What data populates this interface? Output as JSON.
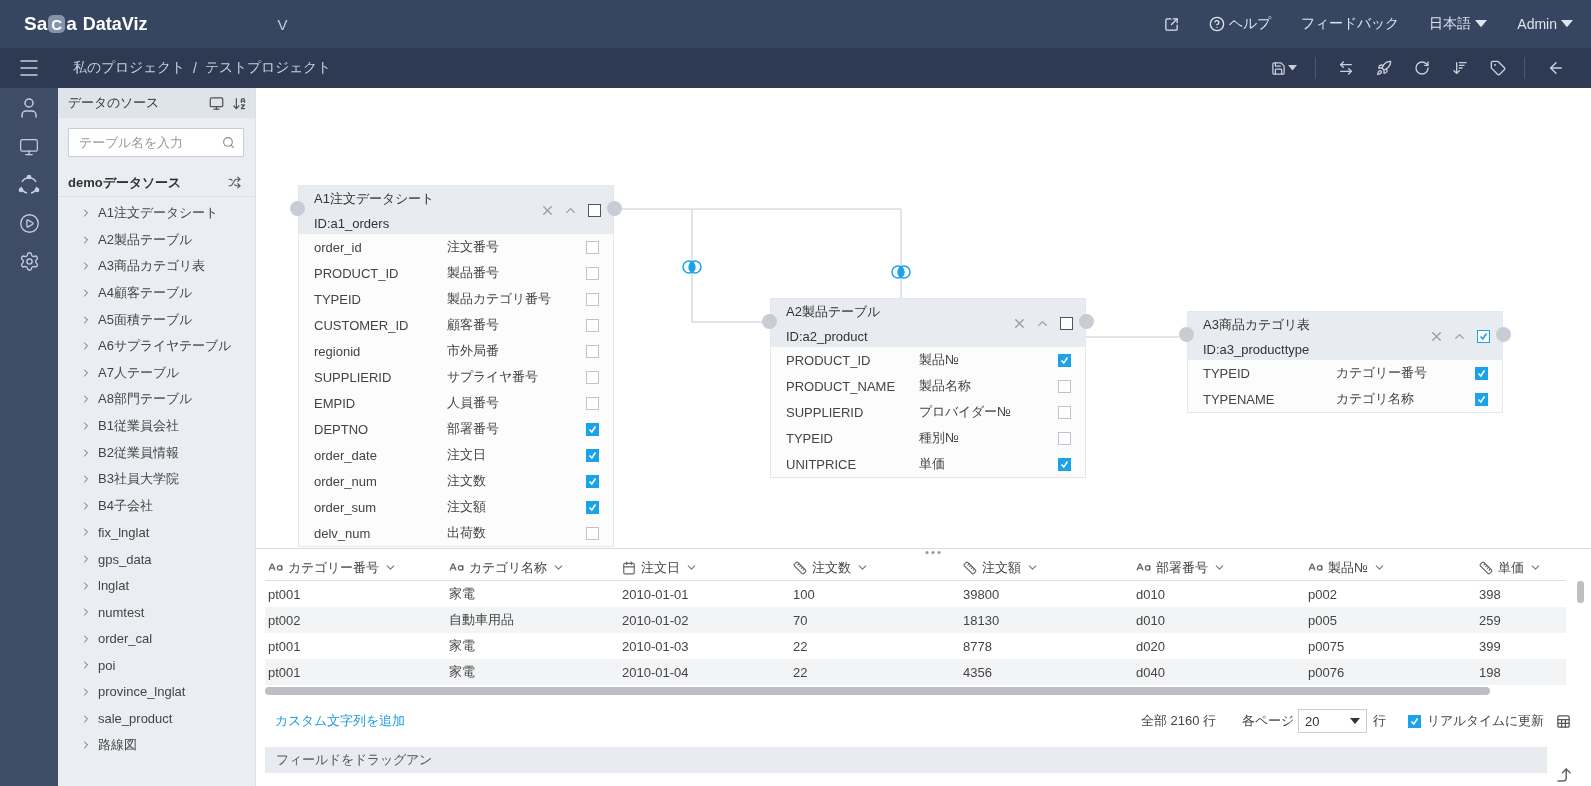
{
  "topbar": {
    "logo": [
      "Sa",
      "C",
      "a"
    ],
    "product": "DataViz",
    "version": "V",
    "help": "ヘルプ",
    "feedback": "フィードバック",
    "language": "日本語",
    "user": "Admin"
  },
  "breadcrumb": {
    "items": [
      "私のプロジェクト",
      "テストプロジェクト"
    ],
    "separator": "/"
  },
  "sidebar": {
    "title": "データのソース",
    "search": {
      "placeholder": "テーブル名を入力"
    },
    "group": "demoデータソース",
    "items": [
      "A1注文データシート",
      "A2製品テーブル",
      "A3商品カテゴリ表",
      "A4顧客テーブル",
      "A5面積テーブル",
      "A6サプライヤテーブル",
      "A7人テーブル",
      "A8部門テーブル",
      "B1従業員会社",
      "B2従業員情報",
      "B3社員大学院",
      "B4子会社",
      "fix_lnglat",
      "gps_data",
      "lnglat",
      "numtest",
      "order_cal",
      "poi",
      "province_lnglat",
      "sale_product",
      "路線図"
    ]
  },
  "nodes": [
    {
      "title": "A1注文データシート",
      "id": "ID:a1_orders",
      "checked": false,
      "fields": [
        {
          "name": "order_id",
          "label": "注文番号",
          "checked": false
        },
        {
          "name": "PRODUCT_ID",
          "label": "製品番号",
          "checked": false
        },
        {
          "name": "TYPEID",
          "label": "製品カテゴリ番号",
          "checked": false
        },
        {
          "name": "CUSTOMER_ID",
          "label": "顧客番号",
          "checked": false
        },
        {
          "name": "regionid",
          "label": "市外局番",
          "checked": false
        },
        {
          "name": "SUPPLIERID",
          "label": "サプライヤ番号",
          "checked": false
        },
        {
          "name": "EMPID",
          "label": "人員番号",
          "checked": false
        },
        {
          "name": "DEPTNO",
          "label": "部署番号",
          "checked": true
        },
        {
          "name": "order_date",
          "label": "注文日",
          "checked": true
        },
        {
          "name": "order_num",
          "label": "注文数",
          "checked": true
        },
        {
          "name": "order_sum",
          "label": "注文額",
          "checked": true
        },
        {
          "name": "delv_num",
          "label": "出荷数",
          "checked": false
        }
      ]
    },
    {
      "title": "A2製品テーブル",
      "id": "ID:a2_product",
      "checked": false,
      "fields": [
        {
          "name": "PRODUCT_ID",
          "label": "製品№",
          "checked": true
        },
        {
          "name": "PRODUCT_NAME",
          "label": "製品名称",
          "checked": false
        },
        {
          "name": "SUPPLIERID",
          "label": "プロバイダー№",
          "checked": false
        },
        {
          "name": "TYPEID",
          "label": "種別№",
          "checked": false
        },
        {
          "name": "UNITPRICE",
          "label": "単価",
          "checked": true
        }
      ]
    },
    {
      "title": "A3商品カテゴリ表",
      "id": "ID:a3_producttype",
      "checked": true,
      "fields": [
        {
          "name": "TYPEID",
          "label": "カテゴリー番号",
          "checked": true
        },
        {
          "name": "TYPENAME",
          "label": "カテゴリ名称",
          "checked": true
        }
      ]
    }
  ],
  "grid": {
    "columns": [
      {
        "label": "カテゴリー番号",
        "kind": "text"
      },
      {
        "label": "カテゴリ名称",
        "kind": "text"
      },
      {
        "label": "注文日",
        "kind": "date"
      },
      {
        "label": "注文数",
        "kind": "number"
      },
      {
        "label": "注文額",
        "kind": "number"
      },
      {
        "label": "部署番号",
        "kind": "text"
      },
      {
        "label": "製品№",
        "kind": "text"
      },
      {
        "label": "単価",
        "kind": "number"
      }
    ],
    "rows": [
      [
        "pt001",
        "家電",
        "2010-01-01",
        "100",
        "39800",
        "d010",
        "p002",
        "398"
      ],
      [
        "pt002",
        "自動車用品",
        "2010-01-02",
        "70",
        "18130",
        "d010",
        "p005",
        "259"
      ],
      [
        "pt001",
        "家電",
        "2010-01-03",
        "22",
        "8778",
        "d020",
        "p0075",
        "399"
      ],
      [
        "pt001",
        "家電",
        "2010-01-04",
        "22",
        "4356",
        "d040",
        "p0076",
        "198"
      ]
    ]
  },
  "footer": {
    "add_link": "カスタム文字列を追加",
    "total": "全部 2160 行",
    "per_page": "各ページ",
    "page_size": "20",
    "rows_unit": "行",
    "realtime": {
      "label": "リアルタイムに更新",
      "checked": true
    }
  },
  "drop_zone": "フィールドをドラッグアン"
}
